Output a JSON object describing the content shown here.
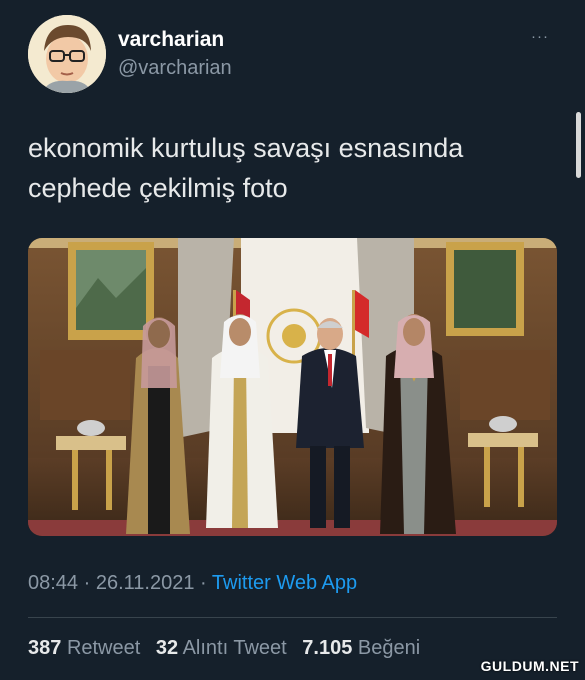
{
  "author": {
    "display_name": "varcharian",
    "handle": "@varcharian",
    "avatar_icon": "boy-with-glasses-avatar"
  },
  "more_label": "···",
  "tweet": {
    "text_line1": "ekonomik kurtuluş savaşı esnasında",
    "text_line2": "cephede çekilmiş foto",
    "media_icon": "photo-four-men-in-ornate-room"
  },
  "meta": {
    "time": "08:44",
    "date": "26.11.2021",
    "separator": " · ",
    "source": "Twitter Web App"
  },
  "stats": {
    "retweets_count": "387",
    "retweets_label": "Retweet",
    "quotes_count": "32",
    "quotes_label": "Alıntı Tweet",
    "likes_count": "7.105",
    "likes_label": "Beğeni"
  },
  "watermark": "GULDUM.NET",
  "colors": {
    "background": "#15202b",
    "text_primary": "#e7e9ea",
    "text_secondary": "#8b98a5",
    "link": "#1d9bf0"
  }
}
